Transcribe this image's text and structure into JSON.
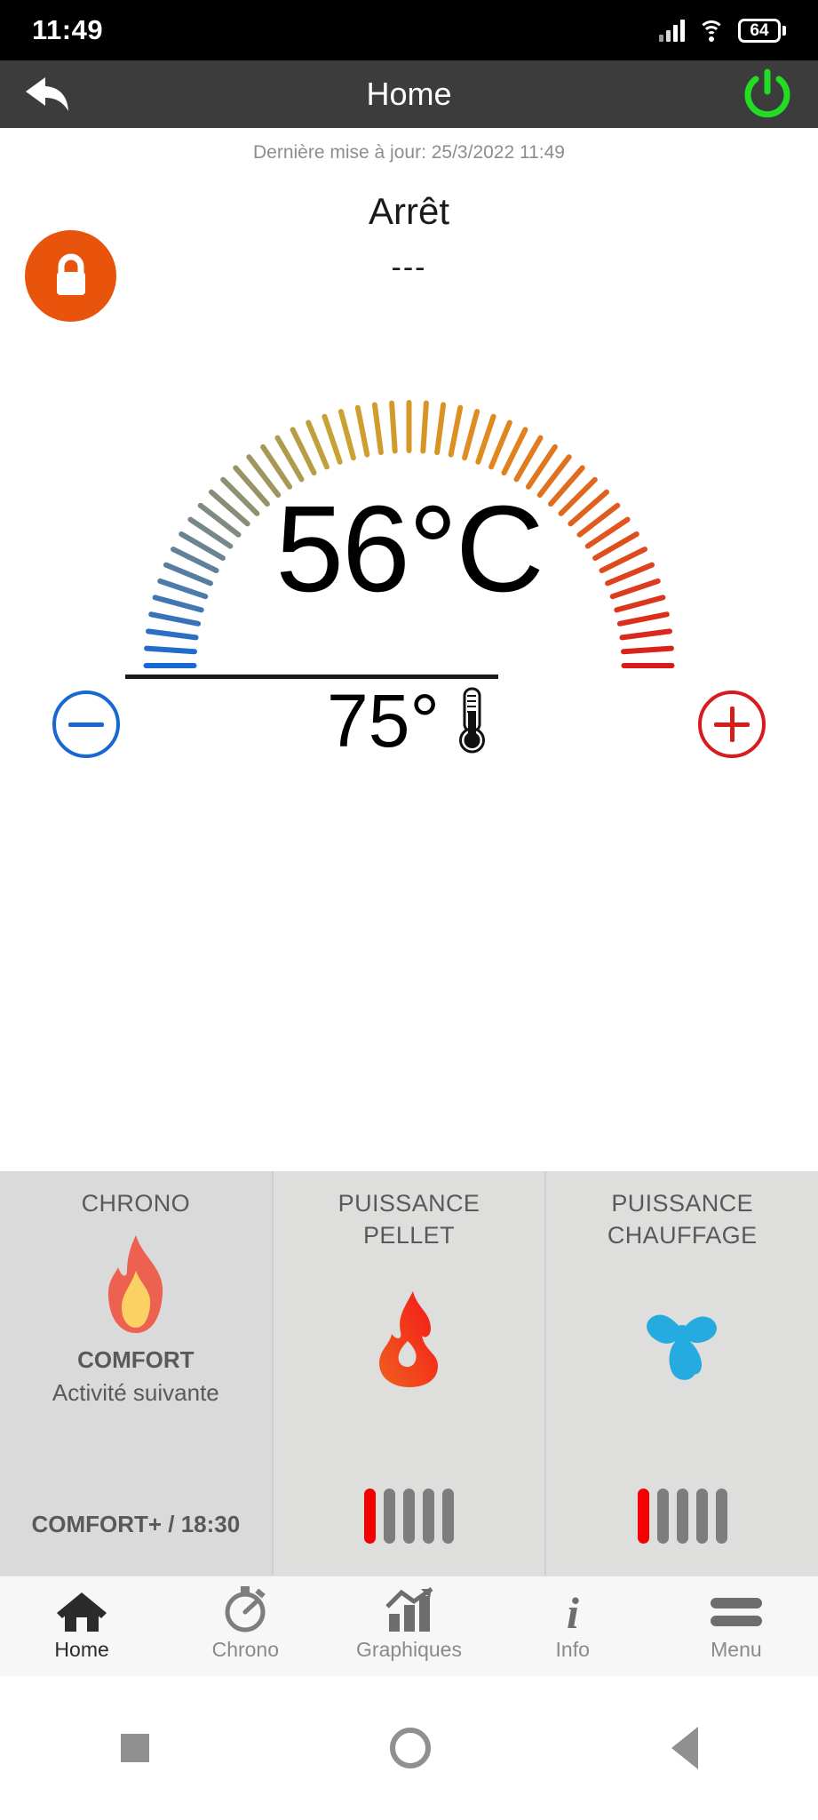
{
  "status_bar": {
    "time": "11:49",
    "battery_level": "64",
    "signal_icon": "signal-bars-icon",
    "wifi_icon": "wifi-icon",
    "battery_icon": "battery-icon"
  },
  "header": {
    "title": "Home",
    "back_icon": "back-arrow-icon",
    "power_icon": "power-icon",
    "power_color": "#22dd22"
  },
  "main": {
    "last_update": "Dernière mise à jour: 25/3/2022 11:49",
    "state": "Arrêt",
    "secondary_state": "---",
    "lock_icon": "lock-icon",
    "lock_color": "#e8540c",
    "temperature": "56°C",
    "setpoint": "75°",
    "thermometer_icon": "thermometer-icon",
    "minus_label": "−",
    "plus_label": "+",
    "minus_color": "#1868d4",
    "plus_color": "#d81b1b"
  },
  "gauge": {
    "tick_count": 49,
    "start_angle": -90,
    "end_angle": 90,
    "colors": [
      "#1868d4",
      "#7c8a84",
      "#c9a333",
      "#e08c1e",
      "#e05a1e",
      "#d81b1b"
    ]
  },
  "tiles": [
    {
      "title": "CHRONO",
      "icon": "flame-icon",
      "label": "COMFORT",
      "sub": "Activité suivante",
      "footer": "COMFORT+ / 18:30"
    },
    {
      "title_line1": "PUISSANCE",
      "title_line2": "PELLET",
      "icon": "fire-icon",
      "bars_total": 5,
      "bars_active": 1
    },
    {
      "title_line1": "PUISSANCE",
      "title_line2": "CHAUFFAGE",
      "icon": "fan-icon",
      "bars_total": 5,
      "bars_active": 1
    }
  ],
  "nav": [
    {
      "label": "Home",
      "icon": "home-icon",
      "active": true
    },
    {
      "label": "Chrono",
      "icon": "timer-icon",
      "active": false
    },
    {
      "label": "Graphiques",
      "icon": "chart-icon",
      "active": false
    },
    {
      "label": "Info",
      "icon": "info-icon",
      "active": false
    },
    {
      "label": "Menu",
      "icon": "hamburger-icon",
      "active": false
    }
  ],
  "system_nav": {
    "recent_icon": "square-icon",
    "home_icon": "circle-icon",
    "back_icon": "triangle-back-icon"
  }
}
